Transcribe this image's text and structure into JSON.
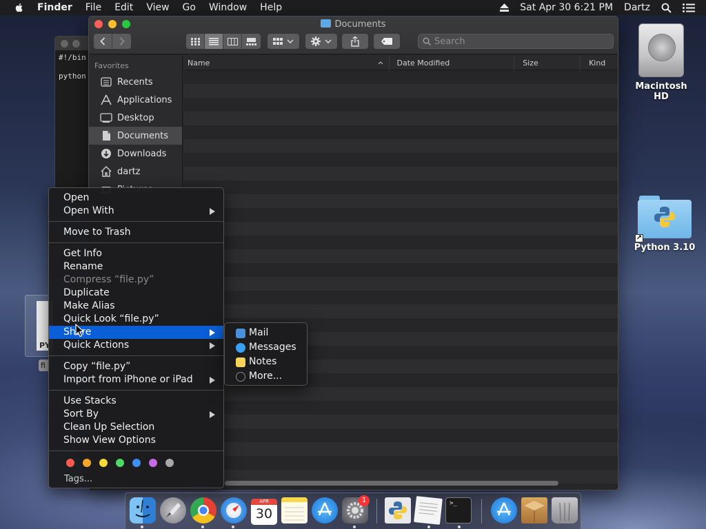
{
  "menubar": {
    "app_name": "Finder",
    "menus": [
      "File",
      "Edit",
      "View",
      "Go",
      "Window",
      "Help"
    ],
    "datetime": "Sat Apr 30  6:21 PM",
    "user": "Dartz"
  },
  "terminal": {
    "lines": [
      "#!/bin",
      "python"
    ]
  },
  "finder": {
    "title": "Documents",
    "search_placeholder": "Search",
    "sidebar_section": "Favorites",
    "sidebar_items": [
      {
        "label": "Recents",
        "icon": "clock-list-icon"
      },
      {
        "label": "Applications",
        "icon": "applications-icon"
      },
      {
        "label": "Desktop",
        "icon": "desktop-icon"
      },
      {
        "label": "Documents",
        "icon": "document-icon",
        "active": true
      },
      {
        "label": "Downloads",
        "icon": "download-icon"
      },
      {
        "label": "dartz",
        "icon": "home-icon"
      },
      {
        "label": "Pictures",
        "icon": "camera-icon"
      }
    ],
    "columns": [
      "Name",
      "Date Modified",
      "Size",
      "Kind"
    ]
  },
  "desktop": {
    "hd_label": "Macintosh HD",
    "python_label": "Python 3.10",
    "selected_file_badge": "PY",
    "selected_file_label": "fi"
  },
  "context_menu": {
    "items": {
      "open": "Open",
      "open_with": "Open With",
      "move_to_trash": "Move to Trash",
      "get_info": "Get Info",
      "rename": "Rename",
      "compress": "Compress “file.py”",
      "duplicate": "Duplicate",
      "make_alias": "Make Alias",
      "quick_look": "Quick Look “file.py”",
      "share": "Share",
      "quick_actions": "Quick Actions",
      "copy": "Copy “file.py”",
      "import_iphone": "Import from iPhone or iPad",
      "use_stacks": "Use Stacks",
      "sort_by": "Sort By",
      "clean_up": "Clean Up Selection",
      "show_view_options": "Show View Options",
      "tags": "Tags..."
    },
    "tag_colors": [
      "#ff5a52",
      "#f9a52a",
      "#f5d83a",
      "#4cd964",
      "#3d8ef5",
      "#c86ae6",
      "#a8a8a8"
    ]
  },
  "share_submenu": {
    "items": [
      {
        "label": "Mail",
        "icon": "mail-icon",
        "color": "#4a90d9"
      },
      {
        "label": "Messages",
        "icon": "messages-icon",
        "color": "#3aa0f5"
      },
      {
        "label": "Notes",
        "icon": "notes-icon",
        "color": "#f5d65a"
      },
      {
        "label": "More...",
        "icon": "more-icon",
        "color": "#888888"
      }
    ]
  },
  "dock": {
    "calendar_month": "APR",
    "calendar_day": "30",
    "badge_count": "1",
    "terminal_prompt": ">_"
  }
}
